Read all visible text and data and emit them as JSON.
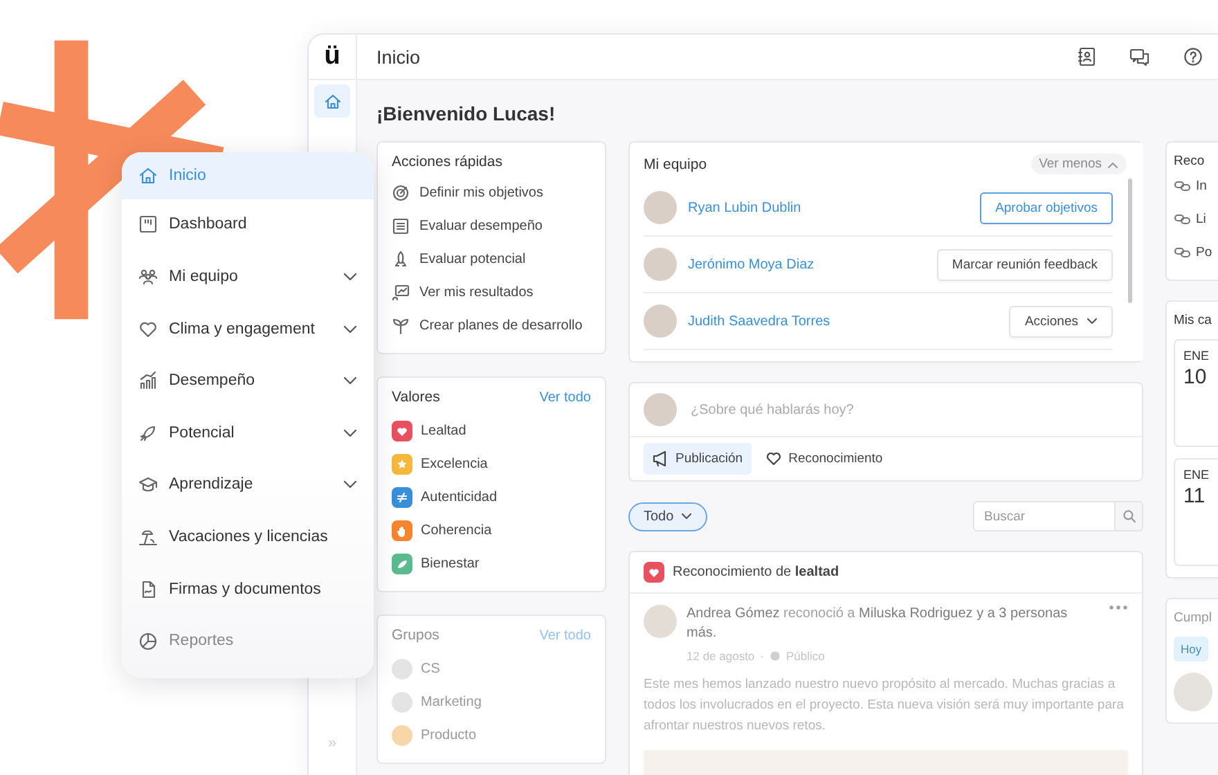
{
  "header": {
    "logo": "ü",
    "title": "Inicio"
  },
  "rail": {
    "expand": "»"
  },
  "welcome": "¡Bienvenido Lucas!",
  "nav_menu": {
    "items": [
      {
        "label": "Inicio",
        "selected": true,
        "expandable": false
      },
      {
        "label": "Dashboard",
        "selected": false,
        "expandable": false
      },
      {
        "label": "Mi equipo",
        "selected": false,
        "expandable": true
      },
      {
        "label": "Clima y engagement",
        "selected": false,
        "expandable": true
      },
      {
        "label": "Desempeño",
        "selected": false,
        "expandable": true
      },
      {
        "label": "Potencial",
        "selected": false,
        "expandable": true
      },
      {
        "label": "Aprendizaje",
        "selected": false,
        "expandable": true
      },
      {
        "label": "Vacaciones y licencias",
        "selected": false,
        "expandable": false
      },
      {
        "label": "Firmas y documentos",
        "selected": false,
        "expandable": false
      },
      {
        "label": "Reportes",
        "selected": false,
        "expandable": false
      }
    ]
  },
  "quick_actions": {
    "title": "Acciones rápidas",
    "items": [
      "Definir mis objetivos",
      "Evaluar desempeño",
      "Evaluar potencial",
      "Ver mis resultados",
      "Crear planes de desarrollo"
    ]
  },
  "values": {
    "title": "Valores",
    "link": "Ver todo",
    "items": [
      {
        "label": "Lealtad",
        "color": "#e8515f"
      },
      {
        "label": "Excelencia",
        "color": "#f6b73c"
      },
      {
        "label": "Autenticidad",
        "color": "#3a8fd9"
      },
      {
        "label": "Coherencia",
        "color": "#f5862f"
      },
      {
        "label": "Bienestar",
        "color": "#5cba8f"
      }
    ]
  },
  "groups": {
    "title": "Grupos",
    "link": "Ver todo",
    "items": [
      {
        "label": "CS",
        "color": "#e4e4e4"
      },
      {
        "label": "Marketing",
        "color": "#e4e4e4"
      },
      {
        "label": "Producto",
        "color": "#f7d6a8"
      }
    ]
  },
  "team": {
    "title": "Mi equipo",
    "toggle": "Ver menos",
    "members": [
      {
        "name": "Ryan Lubin Dublin",
        "action": {
          "label": "Aprobar objetivos",
          "kind": "primary"
        }
      },
      {
        "name": "Jerónimo Moya Diaz",
        "action": {
          "label": "Marcar reunión feedback",
          "kind": "default"
        }
      },
      {
        "name": "Judith Saavedra Torres",
        "action": {
          "label": "Acciones",
          "kind": "dropdown"
        }
      }
    ]
  },
  "composer": {
    "placeholder": "¿Sobre qué hablarás hoy?",
    "tabs": [
      {
        "label": "Publicación",
        "selected": true
      },
      {
        "label": "Reconocimiento",
        "selected": false
      }
    ]
  },
  "feed_filter": {
    "value": "Todo"
  },
  "search": {
    "placeholder": "Buscar"
  },
  "post": {
    "header": "Reconocimiento de **lealtad**",
    "headline": "**Andrea Gómez** reconoció a **Miluska Rodriguez y a 3 personas más.**",
    "date": "12 de agosto",
    "separator": "·",
    "audience": "Público",
    "body": "Este mes hemos lanzado nuestro nuevo propósito al mercado. Muchas gracias a todos los involucrados en el proyecto. Esta nueva visión será muy importante para afrontar nuestros nuevos retos."
  },
  "recommendations": {
    "title": "Reco",
    "items": [
      "In",
      "Li",
      "Po"
    ]
  },
  "trainings": {
    "title": "Mis ca",
    "dates": [
      {
        "month": "ENE",
        "day": "10"
      },
      {
        "month": "ENE",
        "day": "11"
      }
    ]
  },
  "birthdays": {
    "title": "Cumpl",
    "chip": "Hoy"
  }
}
